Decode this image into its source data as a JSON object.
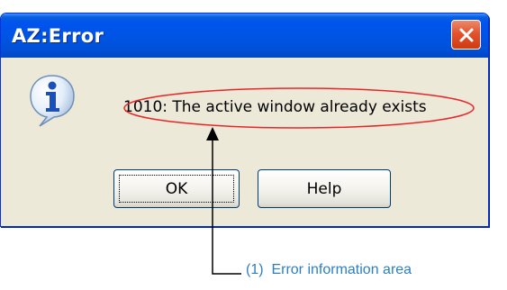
{
  "window": {
    "title": "AZ:Error",
    "close_icon": "close-icon",
    "icon": "information-icon",
    "message": "1010: The active window already exists"
  },
  "buttons": {
    "ok_label": "OK",
    "help_label": "Help"
  },
  "annotation": {
    "label": "(1)  Error information area",
    "ellipse_color": "#e8262a",
    "label_color": "#2d7fc4",
    "arrow_color": "#000000"
  },
  "colors": {
    "titlebar": "#0054e3",
    "dialog_body": "#ece9d8",
    "close_button": "#e2532c"
  }
}
